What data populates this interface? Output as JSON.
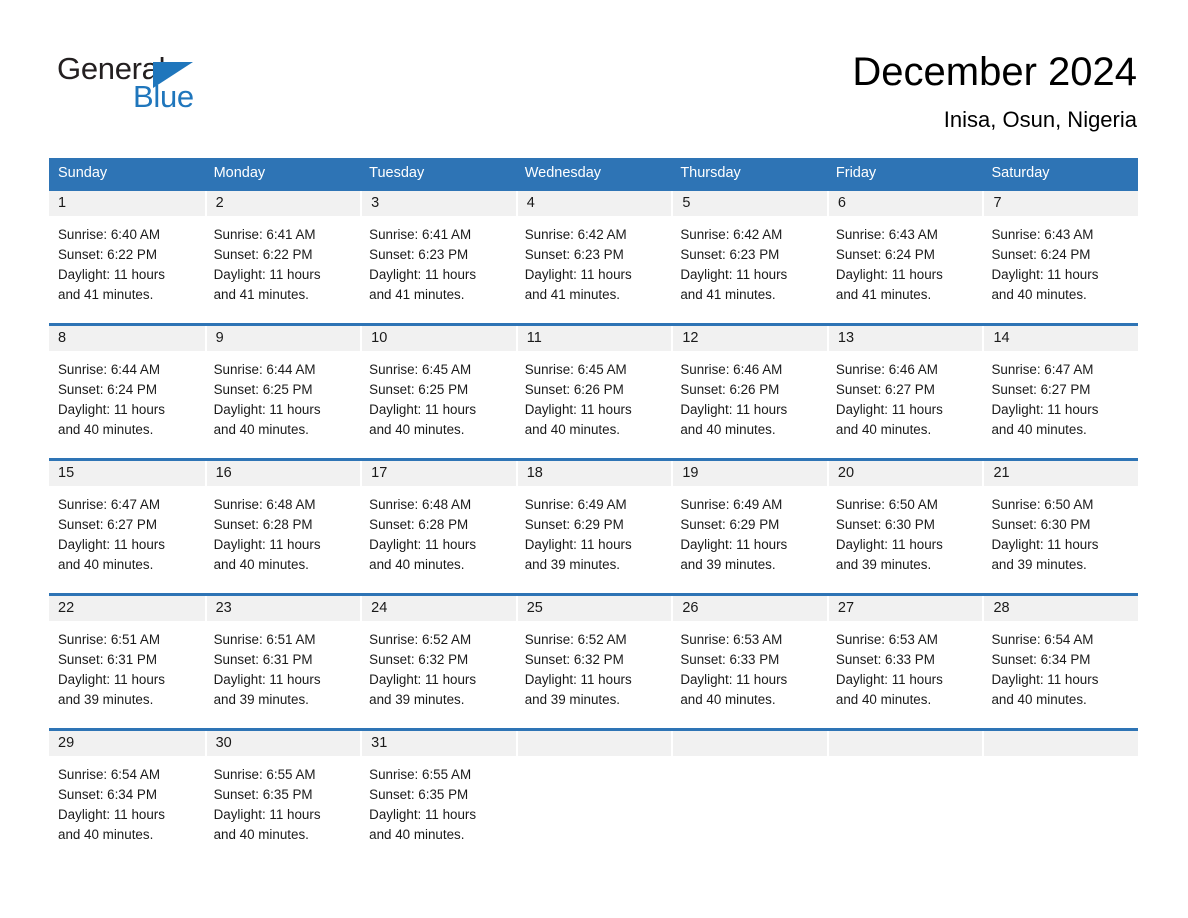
{
  "brand": {
    "name_part1": "General",
    "name_part2": "Blue",
    "triangle_icon": "brand-triangle-icon",
    "accent_color": "#1f76bc"
  },
  "header": {
    "month_title": "December 2024",
    "location": "Inisa, Osun, Nigeria"
  },
  "theme": {
    "header_blue": "#2e74b5",
    "day_band_gray": "#f1f1f1",
    "text_color": "#1a1a1a"
  },
  "calendar": {
    "weekdays": [
      "Sunday",
      "Monday",
      "Tuesday",
      "Wednesday",
      "Thursday",
      "Friday",
      "Saturday"
    ],
    "labels": {
      "sunrise": "Sunrise:",
      "sunset": "Sunset:",
      "daylight": "Daylight:"
    },
    "weeks": [
      [
        {
          "day": "1",
          "sunrise": "Sunrise: 6:40 AM",
          "sunset": "Sunset: 6:22 PM",
          "daylight_line1": "Daylight: 11 hours",
          "daylight_line2": "and 41 minutes."
        },
        {
          "day": "2",
          "sunrise": "Sunrise: 6:41 AM",
          "sunset": "Sunset: 6:22 PM",
          "daylight_line1": "Daylight: 11 hours",
          "daylight_line2": "and 41 minutes."
        },
        {
          "day": "3",
          "sunrise": "Sunrise: 6:41 AM",
          "sunset": "Sunset: 6:23 PM",
          "daylight_line1": "Daylight: 11 hours",
          "daylight_line2": "and 41 minutes."
        },
        {
          "day": "4",
          "sunrise": "Sunrise: 6:42 AM",
          "sunset": "Sunset: 6:23 PM",
          "daylight_line1": "Daylight: 11 hours",
          "daylight_line2": "and 41 minutes."
        },
        {
          "day": "5",
          "sunrise": "Sunrise: 6:42 AM",
          "sunset": "Sunset: 6:23 PM",
          "daylight_line1": "Daylight: 11 hours",
          "daylight_line2": "and 41 minutes."
        },
        {
          "day": "6",
          "sunrise": "Sunrise: 6:43 AM",
          "sunset": "Sunset: 6:24 PM",
          "daylight_line1": "Daylight: 11 hours",
          "daylight_line2": "and 41 minutes."
        },
        {
          "day": "7",
          "sunrise": "Sunrise: 6:43 AM",
          "sunset": "Sunset: 6:24 PM",
          "daylight_line1": "Daylight: 11 hours",
          "daylight_line2": "and 40 minutes."
        }
      ],
      [
        {
          "day": "8",
          "sunrise": "Sunrise: 6:44 AM",
          "sunset": "Sunset: 6:24 PM",
          "daylight_line1": "Daylight: 11 hours",
          "daylight_line2": "and 40 minutes."
        },
        {
          "day": "9",
          "sunrise": "Sunrise: 6:44 AM",
          "sunset": "Sunset: 6:25 PM",
          "daylight_line1": "Daylight: 11 hours",
          "daylight_line2": "and 40 minutes."
        },
        {
          "day": "10",
          "sunrise": "Sunrise: 6:45 AM",
          "sunset": "Sunset: 6:25 PM",
          "daylight_line1": "Daylight: 11 hours",
          "daylight_line2": "and 40 minutes."
        },
        {
          "day": "11",
          "sunrise": "Sunrise: 6:45 AM",
          "sunset": "Sunset: 6:26 PM",
          "daylight_line1": "Daylight: 11 hours",
          "daylight_line2": "and 40 minutes."
        },
        {
          "day": "12",
          "sunrise": "Sunrise: 6:46 AM",
          "sunset": "Sunset: 6:26 PM",
          "daylight_line1": "Daylight: 11 hours",
          "daylight_line2": "and 40 minutes."
        },
        {
          "day": "13",
          "sunrise": "Sunrise: 6:46 AM",
          "sunset": "Sunset: 6:27 PM",
          "daylight_line1": "Daylight: 11 hours",
          "daylight_line2": "and 40 minutes."
        },
        {
          "day": "14",
          "sunrise": "Sunrise: 6:47 AM",
          "sunset": "Sunset: 6:27 PM",
          "daylight_line1": "Daylight: 11 hours",
          "daylight_line2": "and 40 minutes."
        }
      ],
      [
        {
          "day": "15",
          "sunrise": "Sunrise: 6:47 AM",
          "sunset": "Sunset: 6:27 PM",
          "daylight_line1": "Daylight: 11 hours",
          "daylight_line2": "and 40 minutes."
        },
        {
          "day": "16",
          "sunrise": "Sunrise: 6:48 AM",
          "sunset": "Sunset: 6:28 PM",
          "daylight_line1": "Daylight: 11 hours",
          "daylight_line2": "and 40 minutes."
        },
        {
          "day": "17",
          "sunrise": "Sunrise: 6:48 AM",
          "sunset": "Sunset: 6:28 PM",
          "daylight_line1": "Daylight: 11 hours",
          "daylight_line2": "and 40 minutes."
        },
        {
          "day": "18",
          "sunrise": "Sunrise: 6:49 AM",
          "sunset": "Sunset: 6:29 PM",
          "daylight_line1": "Daylight: 11 hours",
          "daylight_line2": "and 39 minutes."
        },
        {
          "day": "19",
          "sunrise": "Sunrise: 6:49 AM",
          "sunset": "Sunset: 6:29 PM",
          "daylight_line1": "Daylight: 11 hours",
          "daylight_line2": "and 39 minutes."
        },
        {
          "day": "20",
          "sunrise": "Sunrise: 6:50 AM",
          "sunset": "Sunset: 6:30 PM",
          "daylight_line1": "Daylight: 11 hours",
          "daylight_line2": "and 39 minutes."
        },
        {
          "day": "21",
          "sunrise": "Sunrise: 6:50 AM",
          "sunset": "Sunset: 6:30 PM",
          "daylight_line1": "Daylight: 11 hours",
          "daylight_line2": "and 39 minutes."
        }
      ],
      [
        {
          "day": "22",
          "sunrise": "Sunrise: 6:51 AM",
          "sunset": "Sunset: 6:31 PM",
          "daylight_line1": "Daylight: 11 hours",
          "daylight_line2": "and 39 minutes."
        },
        {
          "day": "23",
          "sunrise": "Sunrise: 6:51 AM",
          "sunset": "Sunset: 6:31 PM",
          "daylight_line1": "Daylight: 11 hours",
          "daylight_line2": "and 39 minutes."
        },
        {
          "day": "24",
          "sunrise": "Sunrise: 6:52 AM",
          "sunset": "Sunset: 6:32 PM",
          "daylight_line1": "Daylight: 11 hours",
          "daylight_line2": "and 39 minutes."
        },
        {
          "day": "25",
          "sunrise": "Sunrise: 6:52 AM",
          "sunset": "Sunset: 6:32 PM",
          "daylight_line1": "Daylight: 11 hours",
          "daylight_line2": "and 39 minutes."
        },
        {
          "day": "26",
          "sunrise": "Sunrise: 6:53 AM",
          "sunset": "Sunset: 6:33 PM",
          "daylight_line1": "Daylight: 11 hours",
          "daylight_line2": "and 40 minutes."
        },
        {
          "day": "27",
          "sunrise": "Sunrise: 6:53 AM",
          "sunset": "Sunset: 6:33 PM",
          "daylight_line1": "Daylight: 11 hours",
          "daylight_line2": "and 40 minutes."
        },
        {
          "day": "28",
          "sunrise": "Sunrise: 6:54 AM",
          "sunset": "Sunset: 6:34 PM",
          "daylight_line1": "Daylight: 11 hours",
          "daylight_line2": "and 40 minutes."
        }
      ],
      [
        {
          "day": "29",
          "sunrise": "Sunrise: 6:54 AM",
          "sunset": "Sunset: 6:34 PM",
          "daylight_line1": "Daylight: 11 hours",
          "daylight_line2": "and 40 minutes."
        },
        {
          "day": "30",
          "sunrise": "Sunrise: 6:55 AM",
          "sunset": "Sunset: 6:35 PM",
          "daylight_line1": "Daylight: 11 hours",
          "daylight_line2": "and 40 minutes."
        },
        {
          "day": "31",
          "sunrise": "Sunrise: 6:55 AM",
          "sunset": "Sunset: 6:35 PM",
          "daylight_line1": "Daylight: 11 hours",
          "daylight_line2": "and 40 minutes."
        },
        {
          "day": "",
          "sunrise": "",
          "sunset": "",
          "daylight_line1": "",
          "daylight_line2": ""
        },
        {
          "day": "",
          "sunrise": "",
          "sunset": "",
          "daylight_line1": "",
          "daylight_line2": ""
        },
        {
          "day": "",
          "sunrise": "",
          "sunset": "",
          "daylight_line1": "",
          "daylight_line2": ""
        },
        {
          "day": "",
          "sunrise": "",
          "sunset": "",
          "daylight_line1": "",
          "daylight_line2": ""
        }
      ]
    ]
  }
}
